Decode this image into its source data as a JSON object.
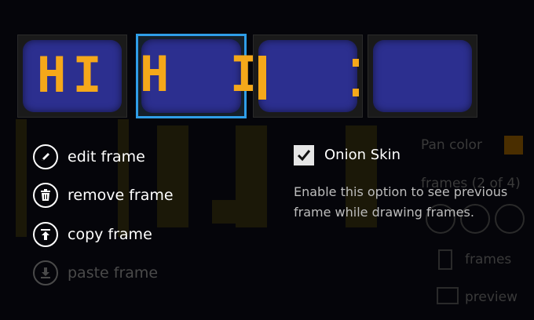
{
  "frames": [
    {
      "content": "HI"
    },
    {
      "content": "H I"
    },
    {
      "content": "I"
    },
    {
      "content": ""
    }
  ],
  "actions": [
    {
      "label": "edit frame",
      "icon": "pencil-icon",
      "enabled": true
    },
    {
      "label": "remove frame",
      "icon": "trash-icon",
      "enabled": true
    },
    {
      "label": "copy frame",
      "icon": "upload-icon",
      "enabled": true
    },
    {
      "label": "paste frame",
      "icon": "download-icon",
      "enabled": false
    }
  ],
  "onion_skin": {
    "label": "Onion Skin",
    "checked": true,
    "description": "Enable this option to see previous frame while drawing frames."
  },
  "background": {
    "pan_color_label": "Pan color",
    "frames_count_label": "frames (2 of 4)",
    "frames_label": "frames",
    "preview_label": "preview"
  },
  "colors": {
    "selected_border": "#2f9ee8",
    "screen_blue": "#2c2f8f",
    "pixel_orange": "#f5a81a"
  }
}
